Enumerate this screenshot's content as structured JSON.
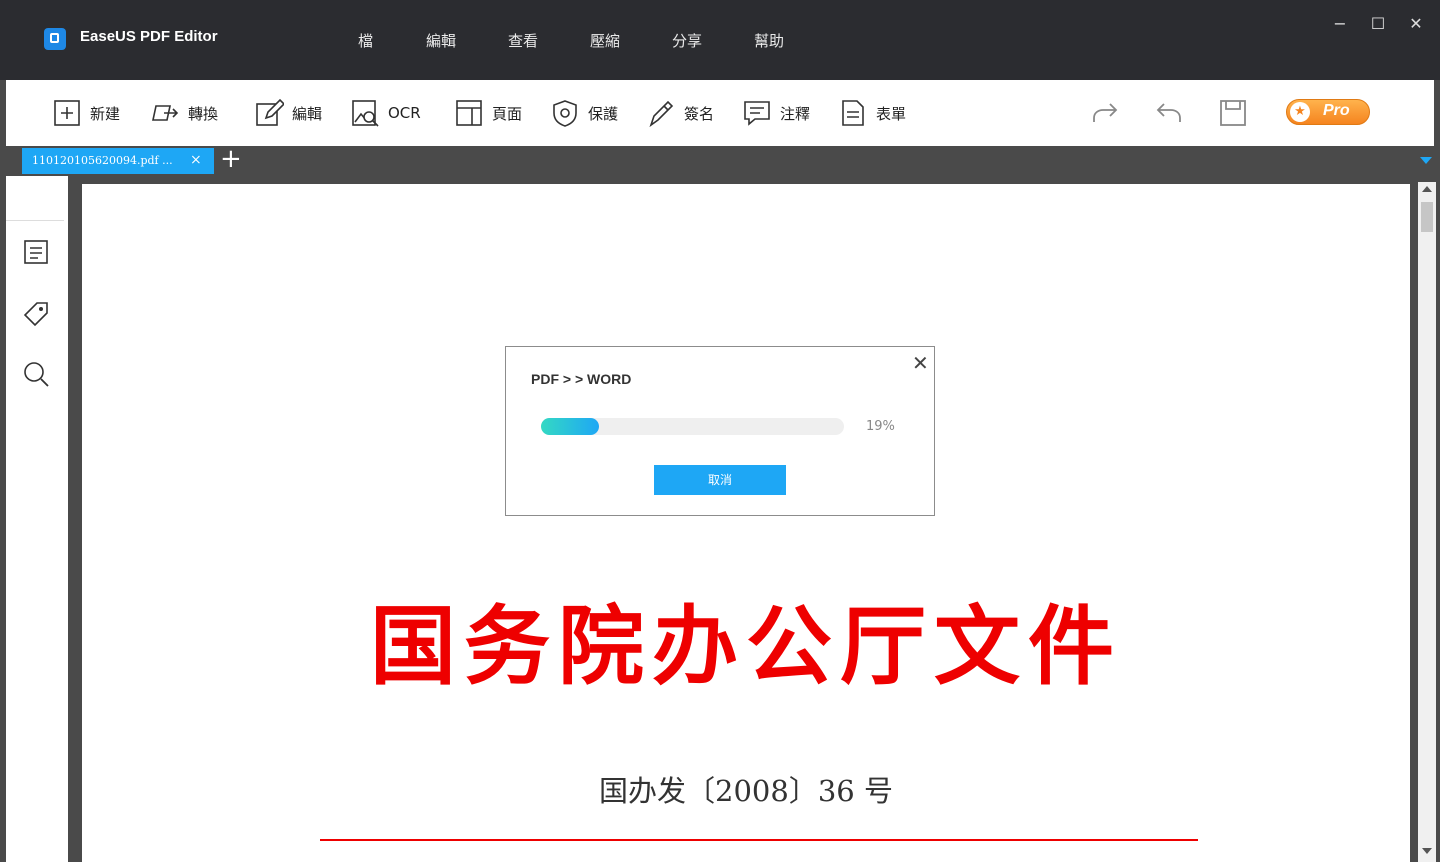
{
  "app": {
    "title": "EaseUS PDF Editor"
  },
  "menu": [
    "檔",
    "編輯",
    "查看",
    "壓縮",
    "分享",
    "幫助"
  ],
  "window_controls": {
    "minimize": "−",
    "maximize": "☐",
    "close": "✕"
  },
  "toolbar": {
    "new": "新建",
    "convert": "轉換",
    "edit": "編輯",
    "ocr": "OCR",
    "page": "頁面",
    "protect": "保護",
    "sign": "簽名",
    "comment": "注釋",
    "form": "表單",
    "pro_label": "Pro"
  },
  "tabs": {
    "items": [
      {
        "label": "110120105620094.pdf ..."
      }
    ],
    "close": "×",
    "add": "+"
  },
  "document": {
    "title": "国务院办公厅文件",
    "number": "国办发〔2008〕36 号"
  },
  "dialog": {
    "title": "PDF > > WORD",
    "close": "✕",
    "progress_percent": 19,
    "progress_label": "19%",
    "cancel_label": "取消"
  },
  "colors": {
    "titlebar": "#2b2c30",
    "accent": "#1ea7f5",
    "doc_red": "#ee0000",
    "pro_orange": "#f5841f"
  }
}
